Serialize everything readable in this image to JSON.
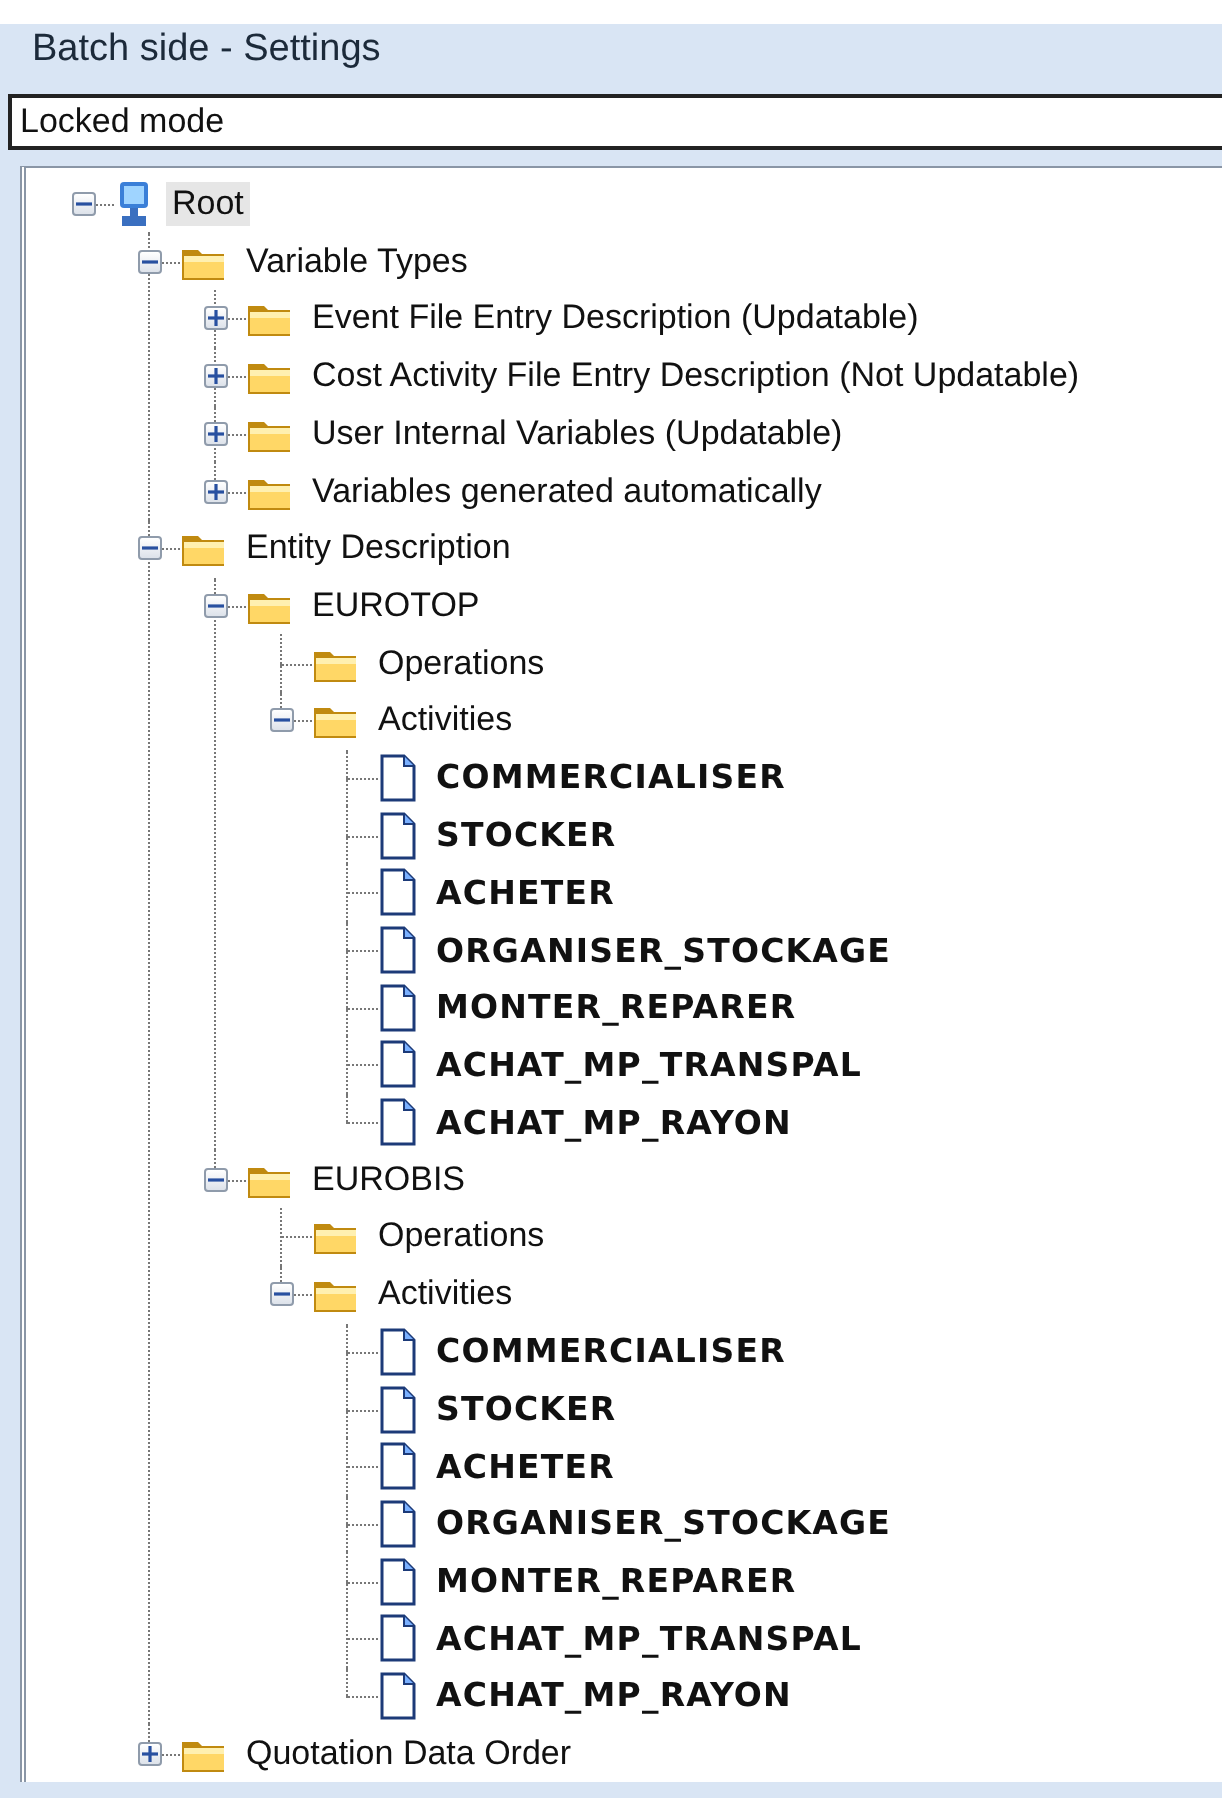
{
  "window": {
    "title": "Batch side - Settings"
  },
  "mode_field": {
    "value": "Locked mode"
  },
  "tree": [
    {
      "label": "Root",
      "kind": "computer",
      "expanded": true,
      "selected": true,
      "children": [
        {
          "label": "Variable Types",
          "kind": "folder",
          "expanded": true,
          "selected": false,
          "children": [
            {
              "label": "Event File Entry Description (Updatable)",
              "kind": "folder",
              "expanded": false,
              "selected": false
            },
            {
              "label": "Cost Activity File Entry Description (Not Updatable)",
              "kind": "folder",
              "expanded": false,
              "selected": false
            },
            {
              "label": "User Internal Variables (Updatable)",
              "kind": "folder",
              "expanded": false,
              "selected": false
            },
            {
              "label": "Variables generated automatically",
              "kind": "folder",
              "expanded": false,
              "selected": false
            }
          ]
        },
        {
          "label": "Entity Description",
          "kind": "folder",
          "expanded": true,
          "selected": false,
          "children": [
            {
              "label": "EUROTOP",
              "kind": "folder",
              "expanded": true,
              "selected": false,
              "children": [
                {
                  "label": "Operations",
                  "kind": "folder",
                  "selected": false
                },
                {
                  "label": "Activities",
                  "kind": "folder",
                  "expanded": true,
                  "selected": false,
                  "children": [
                    {
                      "label": "COMMERCIALISER",
                      "kind": "document",
                      "selected": false
                    },
                    {
                      "label": "STOCKER",
                      "kind": "document",
                      "selected": false
                    },
                    {
                      "label": "ACHETER",
                      "kind": "document",
                      "selected": false
                    },
                    {
                      "label": "ORGANISER_STOCKAGE",
                      "kind": "document",
                      "selected": false
                    },
                    {
                      "label": "MONTER_REPARER",
                      "kind": "document",
                      "selected": false
                    },
                    {
                      "label": "ACHAT_MP_TRANSPAL",
                      "kind": "document",
                      "selected": false
                    },
                    {
                      "label": "ACHAT_MP_RAYON",
                      "kind": "document",
                      "selected": false
                    }
                  ]
                }
              ]
            },
            {
              "label": "EUROBIS",
              "kind": "folder",
              "expanded": true,
              "selected": false,
              "children": [
                {
                  "label": "Operations",
                  "kind": "folder",
                  "selected": false
                },
                {
                  "label": "Activities",
                  "kind": "folder",
                  "expanded": true,
                  "selected": false,
                  "children": [
                    {
                      "label": "COMMERCIALISER",
                      "kind": "document",
                      "selected": false
                    },
                    {
                      "label": "STOCKER",
                      "kind": "document",
                      "selected": false
                    },
                    {
                      "label": "ACHETER",
                      "kind": "document",
                      "selected": false
                    },
                    {
                      "label": "ORGANISER_STOCKAGE",
                      "kind": "document",
                      "selected": false
                    },
                    {
                      "label": "MONTER_REPARER",
                      "kind": "document",
                      "selected": false
                    },
                    {
                      "label": "ACHAT_MP_TRANSPAL",
                      "kind": "document",
                      "selected": false
                    },
                    {
                      "label": "ACHAT_MP_RAYON",
                      "kind": "document",
                      "selected": false
                    }
                  ]
                }
              ]
            }
          ]
        },
        {
          "label": "Quotation Data Order",
          "kind": "folder",
          "expanded": false,
          "selected": false
        }
      ]
    }
  ]
}
